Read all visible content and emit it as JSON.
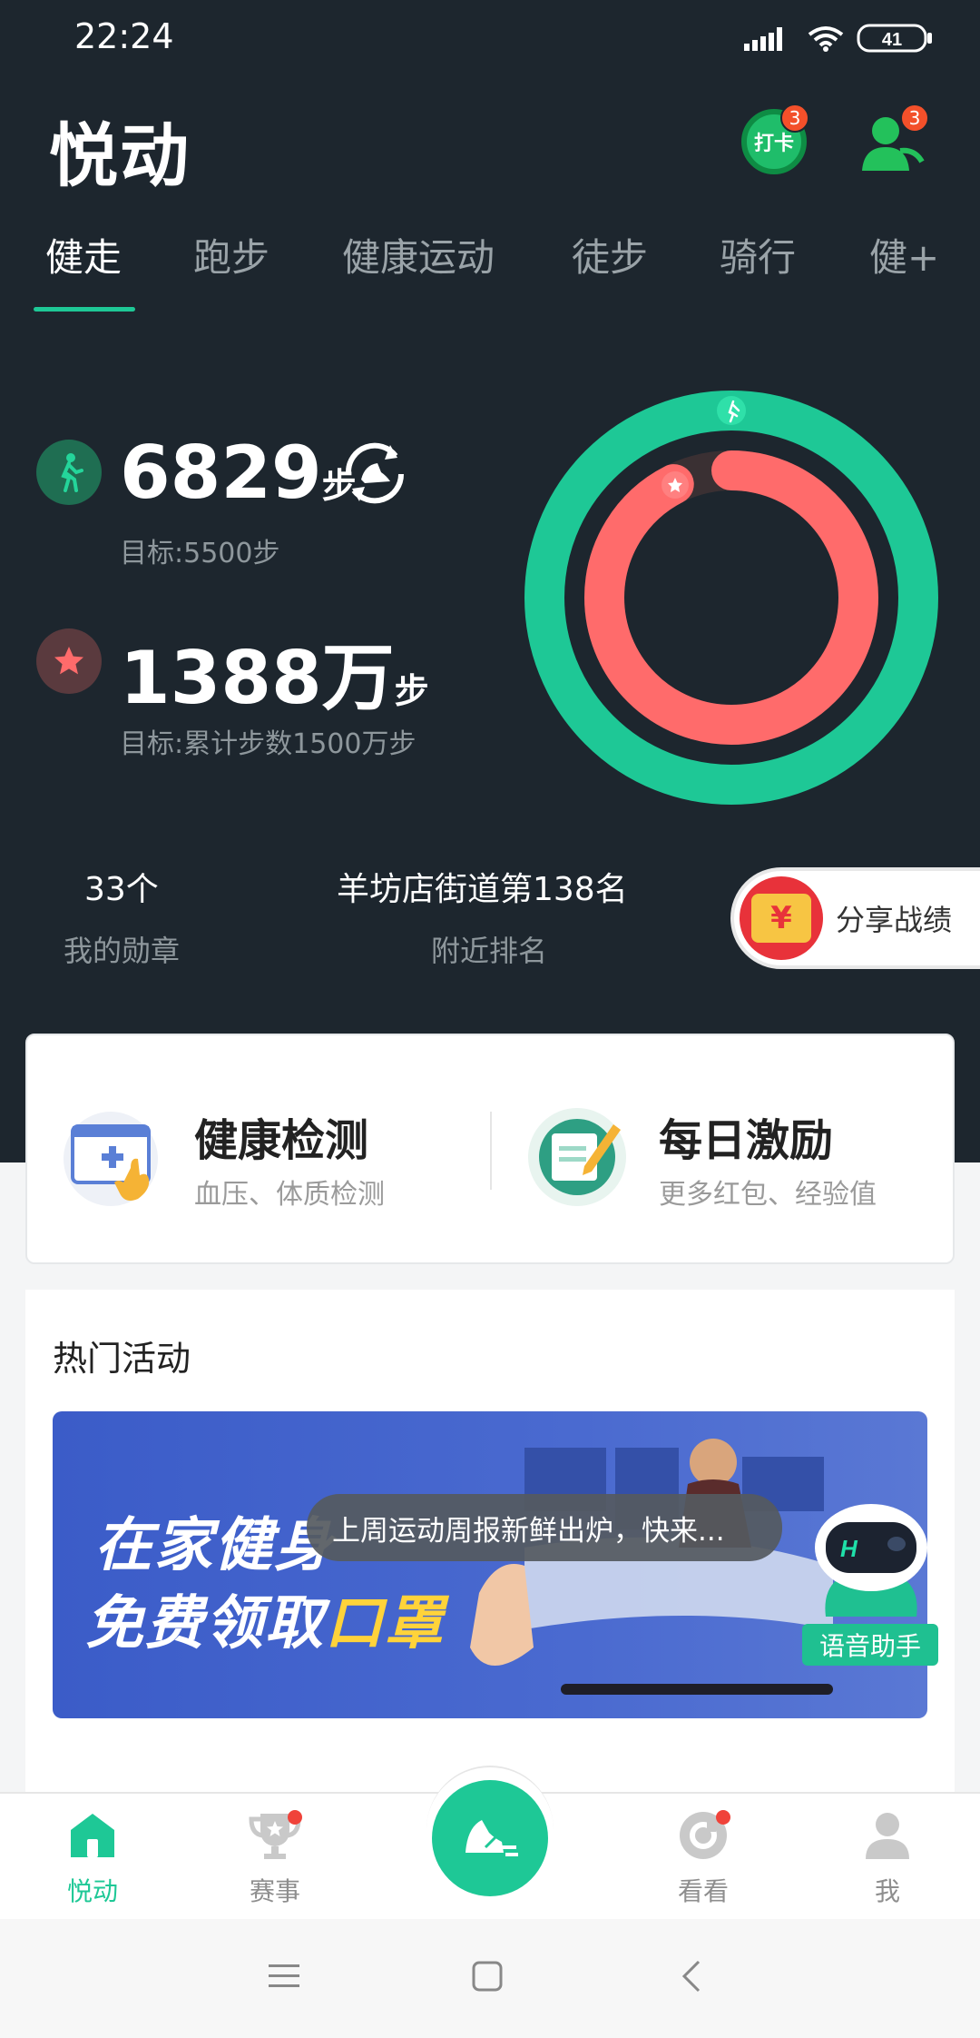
{
  "status_bar": {
    "time": "22:24",
    "battery": "41"
  },
  "header": {
    "title": "悦动",
    "checkin_label": "打卡",
    "checkin_badge": "3",
    "friends_badge": "3"
  },
  "tabs": [
    {
      "label": "健走",
      "active": true
    },
    {
      "label": "跑步",
      "active": false
    },
    {
      "label": "健康运动",
      "active": false
    },
    {
      "label": "徒步",
      "active": false
    },
    {
      "label": "骑行",
      "active": false
    },
    {
      "label": "健+",
      "active": false
    }
  ],
  "today": {
    "steps": "6829",
    "unit": "步",
    "goal_text": "目标:5500步",
    "goal_progress": 1.0
  },
  "total": {
    "steps": "1388万",
    "unit": "步",
    "goal_text": "目标:累计步数1500万步",
    "goal_progress": 0.925
  },
  "metrics": {
    "badges_value": "33个",
    "badges_label": "我的勋章",
    "rank_value": "羊坊店街道第138名",
    "rank_label": "附近排名"
  },
  "share": {
    "label": "分享战绩",
    "coin": "¥"
  },
  "colors": {
    "ring_outer": "#1ec896",
    "ring_inner": "#ff6b6b",
    "accent": "#1ec896",
    "dark_bg": "#1d262e"
  },
  "quick_cards": [
    {
      "title": "健康检测",
      "subtitle": "血压、体质检测"
    },
    {
      "title": "每日激励",
      "subtitle": "更多红包、经验值"
    }
  ],
  "hot_section": {
    "title": "热门活动",
    "banner_line1": "在家健身",
    "banner_line2_prefix": "免费领取",
    "banner_line2_highlight": "口罩"
  },
  "toast": "上周运动周报新鲜出炉，快来...",
  "assistant_label": "语音助手",
  "bottom_nav": [
    {
      "label": "悦动",
      "active": true,
      "icon": "home-icon"
    },
    {
      "label": "赛事",
      "active": false,
      "icon": "trophy-icon"
    },
    {
      "label": "看看",
      "active": false,
      "icon": "discover-icon"
    },
    {
      "label": "我",
      "active": false,
      "icon": "profile-icon"
    }
  ]
}
